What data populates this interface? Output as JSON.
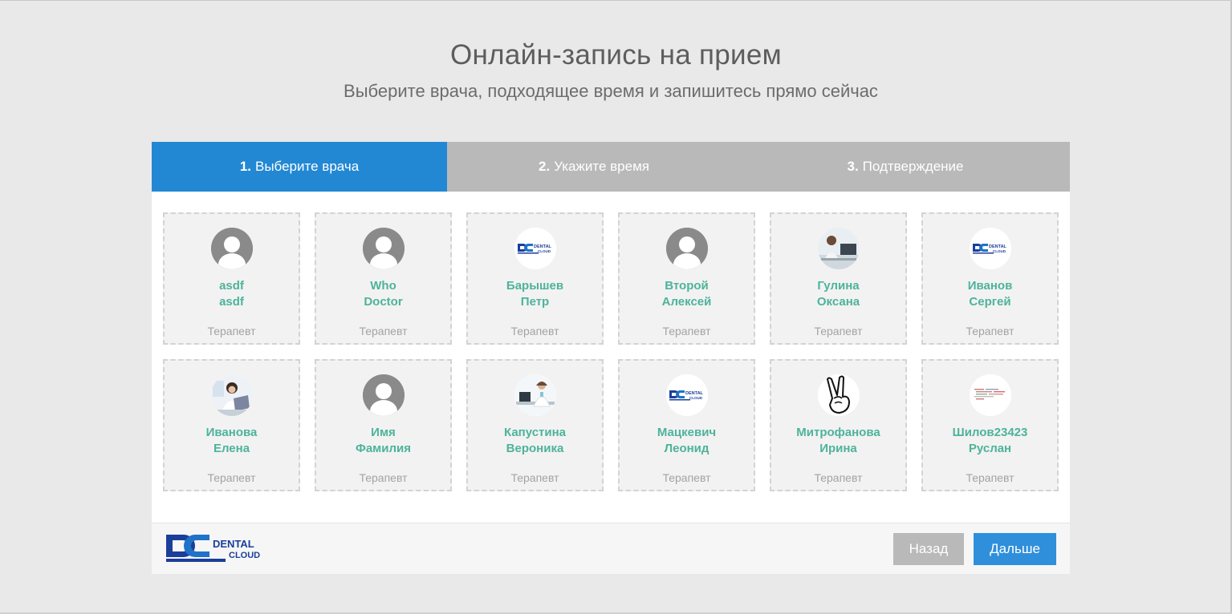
{
  "header": {
    "title": "Онлайн-запись на прием",
    "subtitle": "Выберите врача, подходящее время и запишитесь прямо сейчас"
  },
  "steps": [
    {
      "number": "1.",
      "label": "Выберите врача",
      "active": true
    },
    {
      "number": "2.",
      "label": "Укажите время",
      "active": false
    },
    {
      "number": "3.",
      "label": "Подтверждение",
      "active": false
    }
  ],
  "doctors": [
    {
      "first": "asdf",
      "second": "asdf",
      "role": "Терапевт",
      "avatar": "person-icon"
    },
    {
      "first": "Who",
      "second": "Doctor",
      "role": "Терапевт",
      "avatar": "person-icon"
    },
    {
      "first": "Барышев",
      "second": "Петр",
      "role": "Терапевт",
      "avatar": "dental-cloud-logo"
    },
    {
      "first": "Второй",
      "second": "Алексей",
      "role": "Терапевт",
      "avatar": "person-icon"
    },
    {
      "first": "Гулина",
      "second": "Оксана",
      "role": "Терапевт",
      "avatar": "photo-woman-at-desk"
    },
    {
      "first": "Иванов",
      "second": "Сергей",
      "role": "Терапевт",
      "avatar": "dental-cloud-logo"
    },
    {
      "first": "Иванова",
      "second": "Елена",
      "role": "Терапевт",
      "avatar": "photo-woman-laptop"
    },
    {
      "first": "Имя",
      "second": "Фамилия",
      "role": "Терапевт",
      "avatar": "person-icon"
    },
    {
      "first": "Капустина",
      "second": "Вероника",
      "role": "Терапевт",
      "avatar": "photo-doctor-office"
    },
    {
      "first": "Мацкевич",
      "second": "Леонид",
      "role": "Терапевт",
      "avatar": "dental-cloud-logo"
    },
    {
      "first": "Митрофанова",
      "second": "Ирина",
      "role": "Терапевт",
      "avatar": "victory-hand-icon"
    },
    {
      "first": "Шилов23423",
      "second": "Руслан",
      "role": "Терапевт",
      "avatar": "code-screenshot"
    }
  ],
  "footer": {
    "logo_text_1": "DENTAL",
    "logo_text_2": "CLOUD",
    "back_label": "Назад",
    "next_label": "Дальше"
  },
  "colors": {
    "accent": "#2388d3",
    "name_green": "#4db39a",
    "inactive_step": "#b9b9b9"
  }
}
